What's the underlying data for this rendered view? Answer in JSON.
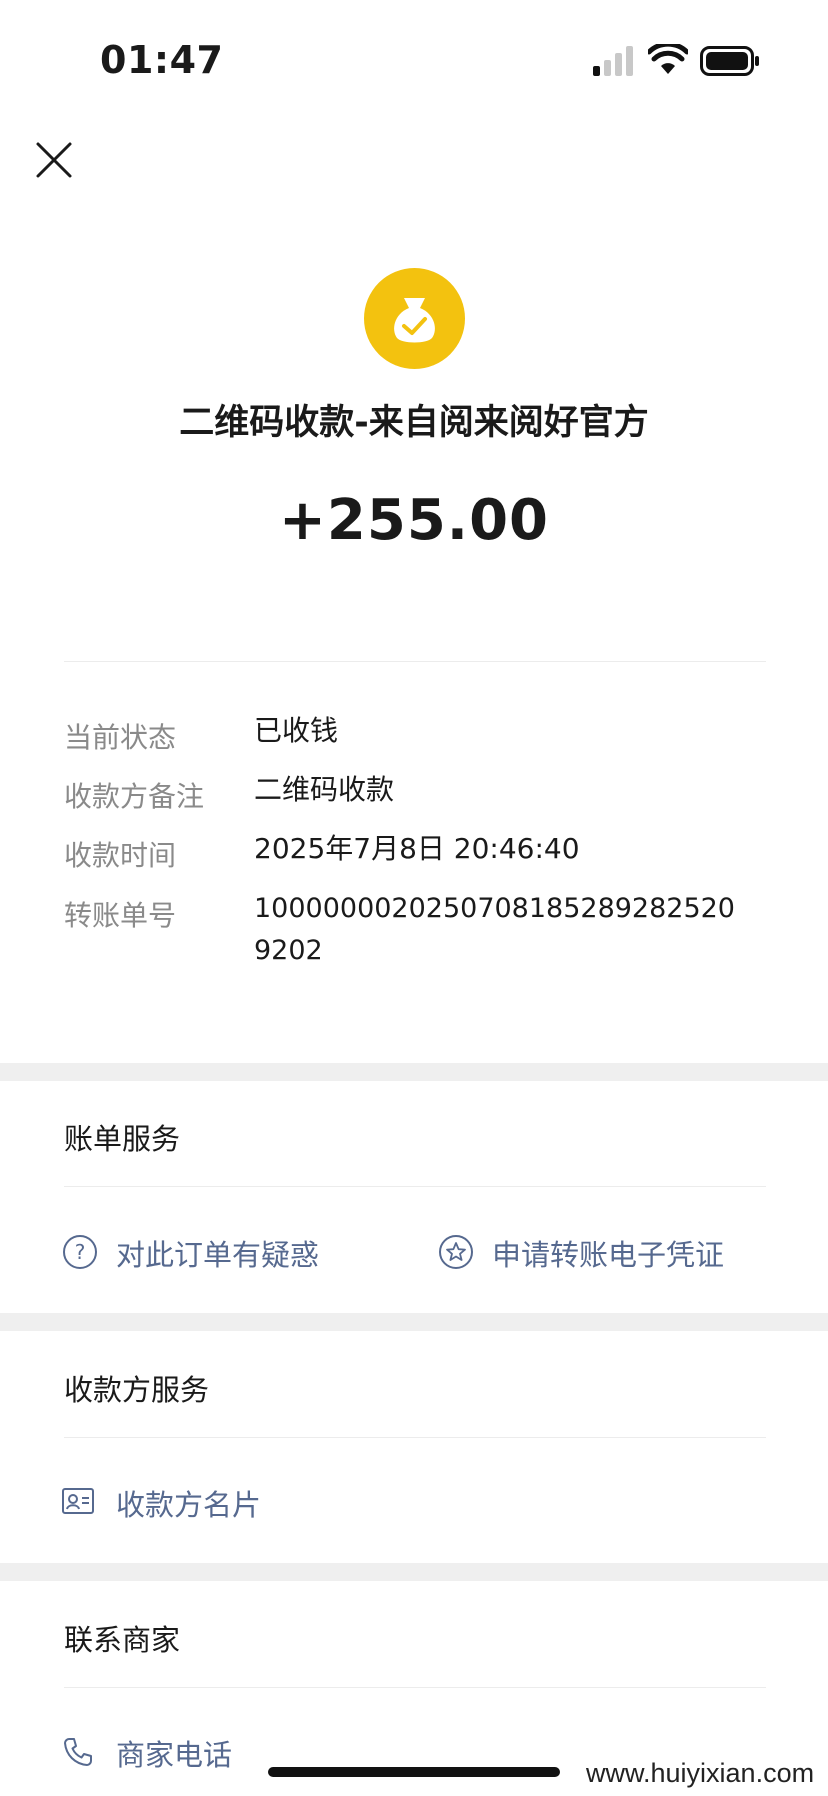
{
  "status_bar": {
    "time": "01:47"
  },
  "header": {
    "close_icon": "close-icon"
  },
  "transaction": {
    "icon": "money-bag-check-icon",
    "title": "二维码收款-来自阅来阅好官方",
    "amount": "+255.00"
  },
  "details": {
    "status_label": "当前状态",
    "status_value": "已收钱",
    "note_label": "收款方备注",
    "note_value": "二维码收款",
    "time_label": "收款时间",
    "time_value": "2025年7月8日 20:46:40",
    "order_label": "转账单号",
    "order_value_line1": "1000000020250708185289282520",
    "order_value_line2": "9202"
  },
  "bill_service": {
    "title": "账单服务",
    "question_label": "对此订单有疑惑",
    "voucher_label": "申请转账电子凭证"
  },
  "payee_service": {
    "title": "收款方服务",
    "card_label": "收款方名片"
  },
  "contact": {
    "title": "联系商家",
    "phone_label": "商家电话"
  },
  "watermark": "www.huiyixian.com",
  "colors": {
    "accent": "#f3c20f",
    "link": "#56698f",
    "label": "#8a8a8a",
    "separator": "#efefef"
  }
}
